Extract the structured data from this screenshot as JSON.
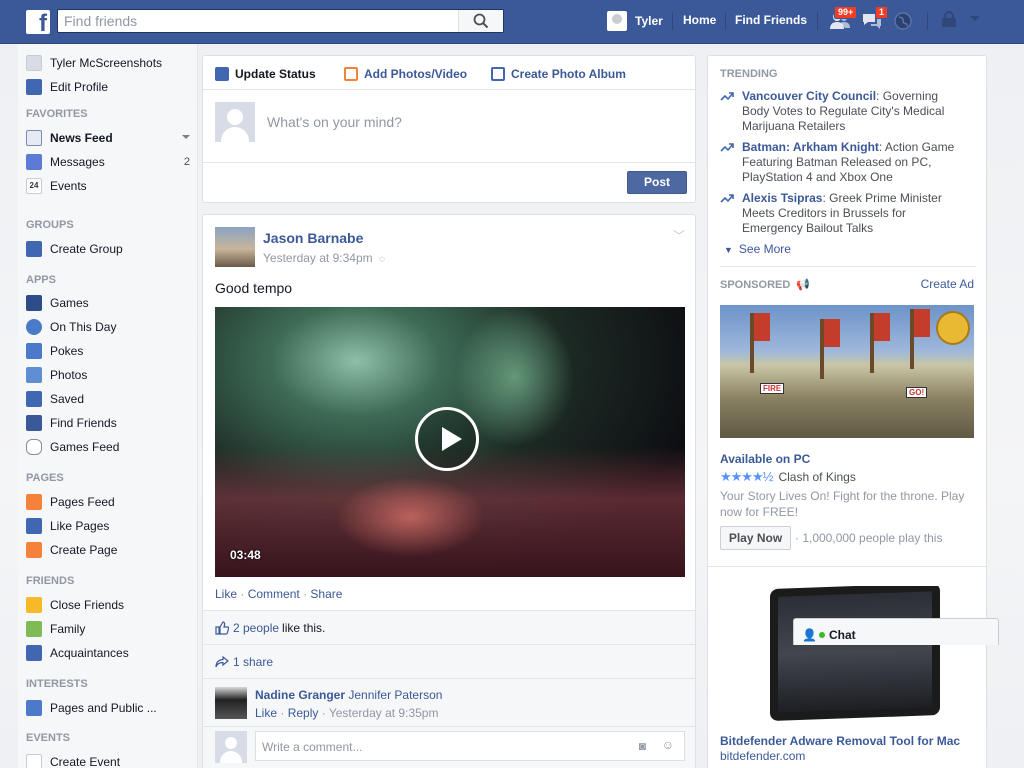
{
  "topbar": {
    "logo": "f",
    "search_placeholder": "Find friends",
    "user_name": "Tyler",
    "home": "Home",
    "find_friends": "Find Friends",
    "friend_requests_badge": "99+",
    "messages_badge": "1"
  },
  "leftnav": {
    "profile_name": "Tyler McScreenshots",
    "edit_profile": "Edit Profile",
    "favorites_header": "FAVORITES",
    "news_feed": "News Feed",
    "messages": "Messages",
    "messages_count": "2",
    "events": "Events",
    "events_icon_text": "24",
    "groups_header": "GROUPS",
    "create_group": "Create Group",
    "apps_header": "APPS",
    "games": "Games",
    "on_this_day": "On This Day",
    "pokes": "Pokes",
    "photos": "Photos",
    "saved": "Saved",
    "find_friends": "Find Friends",
    "games_feed": "Games Feed",
    "pages_header": "PAGES",
    "pages_feed": "Pages Feed",
    "like_pages": "Like Pages",
    "create_page": "Create Page",
    "friends_header": "FRIENDS",
    "close_friends": "Close Friends",
    "family": "Family",
    "acquaintances": "Acquaintances",
    "interests_header": "INTERESTS",
    "pages_public": "Pages and Public ...",
    "events_header": "EVENTS",
    "create_event": "Create Event"
  },
  "composer": {
    "tab_status": "Update Status",
    "tab_photos": "Add Photos/Video",
    "tab_album": "Create Photo Album",
    "placeholder": "What's on your mind?",
    "post": "Post"
  },
  "story": {
    "author": "Jason Barnabe",
    "time": "Yesterday at 9:34pm",
    "text": "Good tempo",
    "duration": "03:48",
    "like": "Like",
    "comment": "Comment",
    "share": "Share",
    "likes_link": "2 people",
    "likes_suffix": "like this.",
    "shares": "1 share",
    "comment_author": "Nadine Granger",
    "comment_tag": "Jennifer Paterson",
    "comment_like": "Like",
    "comment_reply": "Reply",
    "comment_time": "Yesterday at 9:35pm",
    "comment_placeholder": "Write a comment..."
  },
  "rightcol": {
    "trending_header": "TRENDING",
    "trends": [
      {
        "topic": "Vancouver City Council",
        "text": ": Governing Body Votes to Regulate City's Medical Marijuana Retailers"
      },
      {
        "topic": "Batman: Arkham Knight",
        "text": ": Action Game Featuring Batman Released on PC, PlayStation 4 and Xbox One"
      },
      {
        "topic": "Alexis Tsipras",
        "text": ": Greek Prime Minister Meets Creditors in Brussels for Emergency Bailout Talks"
      }
    ],
    "see_more": "See More",
    "sponsored_header": "SPONSORED",
    "create_ad": "Create Ad",
    "ad1_title": "Available on PC",
    "ad1_rating": 4.5,
    "ad1_app": "Clash of Kings",
    "ad1_desc": "Your Story Lives On! Fight for the throne. Play now for FREE!",
    "ad1_button": "Play Now",
    "ad1_people": "· 1,000,000 people play this",
    "ad1_label_fire": "FIRE",
    "ad1_label_go": "GO!",
    "ad2_title": "Bitdefender Adware Removal Tool for Mac",
    "ad2_url": "bitdefender.com"
  },
  "chat": {
    "label": "Chat"
  },
  "colors": {
    "brand": "#3b5998",
    "badge": "#f03d25"
  }
}
